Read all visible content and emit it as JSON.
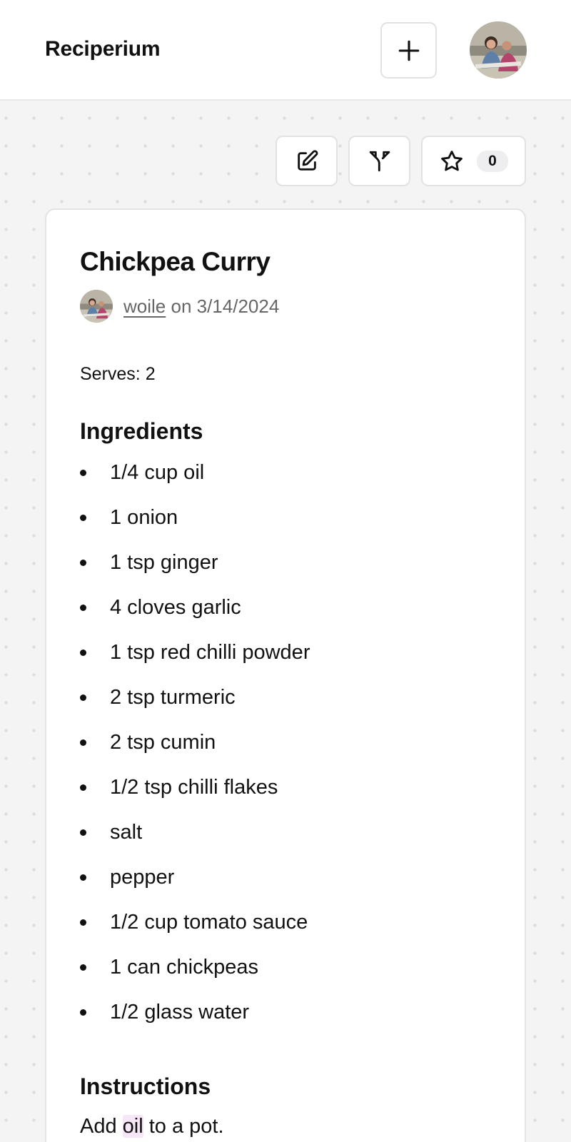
{
  "app": {
    "name": "Reciperium"
  },
  "header": {
    "add_button_icon": "plus-icon",
    "avatar": "user-avatar-photo"
  },
  "actions": {
    "edit_icon": "edit-icon",
    "fork_icon": "fork-icon",
    "star_icon": "star-icon",
    "star_count": "0"
  },
  "recipe": {
    "title": "Chickpea Curry",
    "author": "woile",
    "date_text": "on 3/14/2024",
    "serves": "Serves: 2",
    "ingredients_heading": "Ingredients",
    "ingredients": [
      "1/4 cup oil",
      "1 onion",
      "1 tsp ginger",
      "4 cloves garlic",
      "1 tsp red chilli powder",
      "2 tsp turmeric",
      "2 tsp cumin",
      "1/2 tsp chilli flakes",
      "salt",
      "pepper",
      "1/2 cup tomato sauce",
      "1 can chickpeas",
      "1/2 glass water"
    ],
    "instructions_heading": "Instructions",
    "instructions": [
      {
        "before": "Add ",
        "highlight": "oil",
        "after": " to a pot."
      }
    ]
  },
  "colors": {
    "highlight": "#f6e6f7",
    "background": "#f4f4f5",
    "border": "#e3e3e6"
  }
}
